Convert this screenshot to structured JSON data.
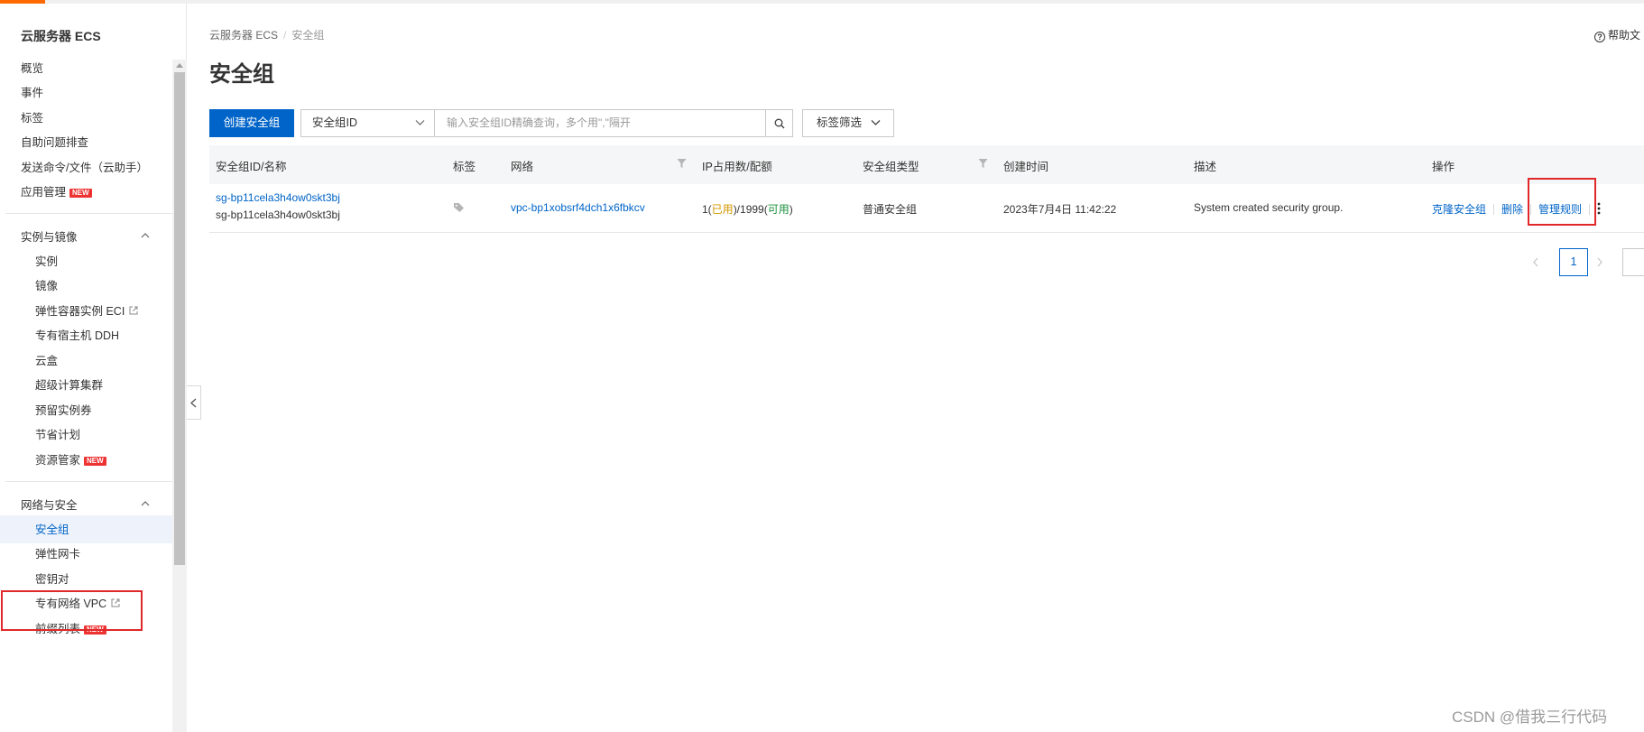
{
  "colors": {
    "accent": "#ff6a00",
    "primary": "#0064c8",
    "highlight": "#e0282a"
  },
  "sidebar": {
    "title": "云服务器 ECS",
    "items_top": [
      {
        "label": "概览"
      },
      {
        "label": "事件"
      },
      {
        "label": "标签"
      },
      {
        "label": "自助问题排查"
      },
      {
        "label": "发送命令/文件（云助手）"
      },
      {
        "label": "应用管理",
        "badge": "NEW"
      }
    ],
    "group1": {
      "label": "实例与镜像",
      "items": [
        {
          "label": "实例"
        },
        {
          "label": "镜像"
        },
        {
          "label": "弹性容器实例 ECI",
          "external": true
        },
        {
          "label": "专有宿主机 DDH"
        },
        {
          "label": "云盒"
        },
        {
          "label": "超级计算集群"
        },
        {
          "label": "预留实例券"
        },
        {
          "label": "节省计划"
        },
        {
          "label": "资源管家",
          "badge": "NEW"
        }
      ]
    },
    "group2": {
      "label": "网络与安全",
      "items": [
        {
          "label": "安全组",
          "active": true
        },
        {
          "label": "弹性网卡"
        },
        {
          "label": "密钥对"
        },
        {
          "label": "专有网络 VPC",
          "external": true
        },
        {
          "label": "前缀列表",
          "badge": "NEW"
        }
      ]
    }
  },
  "breadcrumb": {
    "root": "云服务器 ECS",
    "current": "安全组"
  },
  "page_title": "安全组",
  "help_label": "帮助文",
  "toolbar": {
    "create_label": "创建安全组",
    "select_value": "安全组ID",
    "search_placeholder": "输入安全组ID精确查询，多个用\",\"隔开",
    "tag_filter_label": "标签筛选"
  },
  "table": {
    "columns": {
      "id_name": "安全组ID/名称",
      "tag": "标签",
      "network": "网络",
      "ip_usage": "IP占用数/配额",
      "type": "安全组类型",
      "created": "创建时间",
      "desc": "描述",
      "actions": "操作"
    },
    "rows": [
      {
        "id": "sg-bp11cela3h4ow0skt3bj",
        "name": "sg-bp11cela3h4ow0skt3bj",
        "network": "vpc-bp1xobsrf4dch1x6fbkcv",
        "ip_used_num": "1(",
        "ip_used_label": "已用",
        "ip_mid": ")/1999(",
        "ip_avail_label": "可用",
        "ip_end": ")",
        "type": "普通安全组",
        "created": "2023年7月4日 11:42:22",
        "desc": "System created security group.",
        "actions": {
          "clone": "克隆安全组",
          "delete": "删除",
          "manage": "管理规则"
        }
      }
    ]
  },
  "pagination": {
    "current": "1"
  },
  "watermark": "CSDN @借我三行代码"
}
